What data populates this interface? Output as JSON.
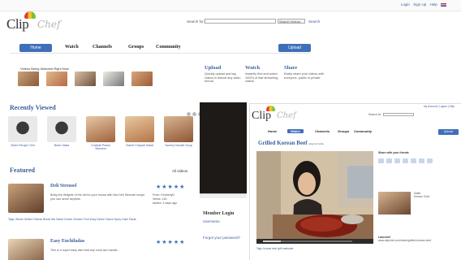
{
  "header": {
    "brand_word": "Clip",
    "brand_script": "Chef",
    "toplinks": [
      "Login",
      "Sign Up",
      "Help"
    ],
    "search_label": "Search for:",
    "search_select": "Search Videos",
    "search_go": "Search"
  },
  "nav": {
    "items": [
      "Home",
      "Watch",
      "Channels",
      "Groups",
      "Community"
    ],
    "upload": "Upload"
  },
  "promo": {
    "strip_title": "Videos Being Watched Right Now",
    "features": [
      {
        "title": "Upload",
        "desc": "Quickly upload and tag videos in almost any video format"
      },
      {
        "title": "Watch",
        "desc": "Instantly find and watch 1000's of fast streaming videos"
      },
      {
        "title": "Share",
        "desc": "Easily share your videos with everyone, public or private"
      }
    ]
  },
  "recently_viewed": {
    "title": "Recently Viewed",
    "items": [
      {
        "caption": "Bob's Recipe Chili"
      },
      {
        "caption": "Bean Salsa"
      },
      {
        "caption": "Cocktail Prawn Skewers"
      },
      {
        "caption": "Sweet Chapati Salad"
      },
      {
        "caption": "Yummy Noodle Soup"
      }
    ]
  },
  "featured": {
    "title": "Featured",
    "filter": "All videos",
    "items": [
      {
        "title": "Deli Streusel",
        "desc": "Bring the delights of the deli to your house with this Deli Streusel recipe you can serve anytime.",
        "stars": "★★★★★",
        "meta": [
          "From: KimberlyD",
          "Views: 145",
          "Added: 3 days ago"
        ]
      },
      {
        "title": "Easy Enchiladas",
        "desc": "This is a super easy dish that any cook can handle."
      }
    ],
    "tags": "Tags: Whole Grilled Cheese Bread Mix Salad Cream Chicken Fruit Easy Dinner Sauce Spicy Cake Pasta"
  },
  "side": {
    "member_login": "Member Login",
    "username": "Username",
    "forgot": "Forgot your password?"
  },
  "inset": {
    "title": "Grilled Korean Beef",
    "title_meta": "added by Sallie",
    "search_label": "Search for",
    "toplinks": "My Account | Logout | Help",
    "nav": [
      "Home",
      "Watch",
      "Channels",
      "Groups",
      "Community"
    ],
    "upload": "Upload",
    "side_heading": "Share with your friends",
    "user_name": "Sallie",
    "user_sub": "Korean Chef",
    "links_label": "Lanechef",
    "share_url": "www.clipchef.com/video/grilled-korean-beef",
    "below_player": "Tags: korean beef grill marinade"
  }
}
